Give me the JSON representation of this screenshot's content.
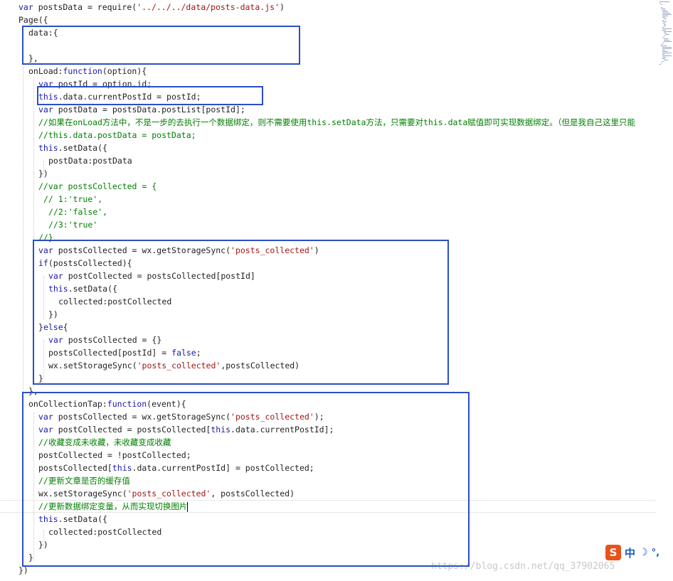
{
  "editor": {
    "lines": [
      {
        "indent": 3,
        "tokens": [
          {
            "t": "var",
            "c": "kw"
          },
          {
            "t": " postsData = require("
          },
          {
            "t": "'../../../data/posts-data.js'",
            "c": "str"
          },
          {
            "t": ")"
          }
        ]
      },
      {
        "indent": 3,
        "tokens": [
          {
            "t": "Page({"
          }
        ]
      },
      {
        "indent": 5,
        "tokens": [
          {
            "t": "data:{"
          }
        ]
      },
      {
        "indent": 0,
        "tokens": []
      },
      {
        "indent": 5,
        "tokens": [
          {
            "t": "},"
          }
        ]
      },
      {
        "indent": 5,
        "tokens": [
          {
            "t": "onLoad:"
          },
          {
            "t": "function",
            "c": "kw"
          },
          {
            "t": "(option){"
          }
        ]
      },
      {
        "indent": 7,
        "tokens": [
          {
            "t": "var",
            "c": "kw"
          },
          {
            "t": " postId = option.id;"
          }
        ]
      },
      {
        "indent": 7,
        "tokens": [
          {
            "t": "this",
            "c": "kw"
          },
          {
            "t": ".data.currentPostId = postId;"
          }
        ]
      },
      {
        "indent": 7,
        "tokens": [
          {
            "t": "var",
            "c": "kw"
          },
          {
            "t": " postData = postsData.postList[postId];"
          }
        ]
      },
      {
        "indent": 7,
        "tokens": [
          {
            "t": "//如果在onLoad方法中，不是一步的去执行一个数据绑定，则不需要使用this.setData方法，只需要对this.data赋值即可实现数据绑定。（但是我自己这里只能",
            "c": "cm"
          }
        ]
      },
      {
        "indent": 7,
        "tokens": [
          {
            "t": "//this.data.postData = postData;",
            "c": "cm"
          }
        ]
      },
      {
        "indent": 7,
        "tokens": [
          {
            "t": "this",
            "c": "kw"
          },
          {
            "t": ".setData({"
          }
        ]
      },
      {
        "indent": 9,
        "tokens": [
          {
            "t": "postData:postData"
          }
        ]
      },
      {
        "indent": 7,
        "tokens": [
          {
            "t": "})"
          }
        ]
      },
      {
        "indent": 7,
        "tokens": [
          {
            "t": "//var postsCollected = {",
            "c": "cm"
          }
        ]
      },
      {
        "indent": 8,
        "tokens": [
          {
            "t": "// 1:'true',",
            "c": "cm"
          }
        ]
      },
      {
        "indent": 9,
        "tokens": [
          {
            "t": "//2:'false',",
            "c": "cm"
          }
        ]
      },
      {
        "indent": 9,
        "tokens": [
          {
            "t": "//3:'true'",
            "c": "cm"
          }
        ]
      },
      {
        "indent": 7,
        "tokens": [
          {
            "t": "//}",
            "c": "cm"
          }
        ]
      },
      {
        "indent": 7,
        "tokens": [
          {
            "t": "var",
            "c": "kw"
          },
          {
            "t": " postsCollected = wx.getStorageSync("
          },
          {
            "t": "'posts_collected'",
            "c": "str"
          },
          {
            "t": ")"
          }
        ]
      },
      {
        "indent": 7,
        "tokens": [
          {
            "t": "if",
            "c": "kw"
          },
          {
            "t": "(postsCollected){"
          }
        ]
      },
      {
        "indent": 9,
        "tokens": [
          {
            "t": "var",
            "c": "kw"
          },
          {
            "t": " postCollected = postsCollected[postId]"
          }
        ]
      },
      {
        "indent": 9,
        "tokens": [
          {
            "t": "this",
            "c": "kw"
          },
          {
            "t": ".setData({"
          }
        ]
      },
      {
        "indent": 11,
        "tokens": [
          {
            "t": "collected:postCollected"
          }
        ]
      },
      {
        "indent": 9,
        "tokens": [
          {
            "t": "})"
          }
        ]
      },
      {
        "indent": 7,
        "tokens": [
          {
            "t": "}"
          },
          {
            "t": "else",
            "c": "kw"
          },
          {
            "t": "{"
          }
        ]
      },
      {
        "indent": 9,
        "tokens": [
          {
            "t": "var",
            "c": "kw"
          },
          {
            "t": " postsCollected = {}"
          }
        ]
      },
      {
        "indent": 9,
        "tokens": [
          {
            "t": "postsCollected[postId] = "
          },
          {
            "t": "false",
            "c": "kw"
          },
          {
            "t": ";"
          }
        ]
      },
      {
        "indent": 9,
        "tokens": [
          {
            "t": "wx.setStorageSync("
          },
          {
            "t": "'posts_collected'",
            "c": "str"
          },
          {
            "t": ",postsCollected)"
          }
        ]
      },
      {
        "indent": 7,
        "tokens": [
          {
            "t": "}"
          }
        ]
      },
      {
        "indent": 5,
        "tokens": [
          {
            "t": "},"
          }
        ]
      },
      {
        "indent": 5,
        "tokens": [
          {
            "t": "onCollectionTap:"
          },
          {
            "t": "function",
            "c": "kw"
          },
          {
            "t": "(event){"
          }
        ]
      },
      {
        "indent": 7,
        "tokens": [
          {
            "t": "var",
            "c": "kw"
          },
          {
            "t": " postsCollected = wx.getStorageSync("
          },
          {
            "t": "'posts_collected'",
            "c": "str"
          },
          {
            "t": ");"
          }
        ]
      },
      {
        "indent": 7,
        "tokens": [
          {
            "t": "var",
            "c": "kw"
          },
          {
            "t": " postCollected = postsCollected["
          },
          {
            "t": "this",
            "c": "kw"
          },
          {
            "t": ".data.currentPostId];"
          }
        ]
      },
      {
        "indent": 7,
        "tokens": [
          {
            "t": "//收藏变成未收藏，未收藏变成收藏",
            "c": "cm"
          }
        ]
      },
      {
        "indent": 7,
        "tokens": [
          {
            "t": "postCollected = !postCollected;"
          }
        ]
      },
      {
        "indent": 7,
        "tokens": [
          {
            "t": "postsCollected["
          },
          {
            "t": "this",
            "c": "kw"
          },
          {
            "t": ".data.currentPostId] = postCollected;"
          }
        ]
      },
      {
        "indent": 7,
        "tokens": [
          {
            "t": "//更新文章是否的缓存值",
            "c": "cm"
          }
        ]
      },
      {
        "indent": 7,
        "tokens": [
          {
            "t": "wx.setStorageSync("
          },
          {
            "t": "'posts_collected'",
            "c": "str"
          },
          {
            "t": ", postsCollected)"
          }
        ]
      },
      {
        "indent": 7,
        "tokens": [
          {
            "t": "//更新数据绑定变量，从而实现切换图片",
            "c": "cm"
          }
        ],
        "cursor": true
      },
      {
        "indent": 7,
        "tokens": [
          {
            "t": "this",
            "c": "kw"
          },
          {
            "t": ".setData({"
          }
        ]
      },
      {
        "indent": 9,
        "tokens": [
          {
            "t": "collected:postCollected"
          }
        ]
      },
      {
        "indent": 7,
        "tokens": [
          {
            "t": "})"
          }
        ]
      },
      {
        "indent": 5,
        "tokens": [
          {
            "t": "}"
          }
        ]
      },
      {
        "indent": 3,
        "tokens": [
          {
            "t": "})"
          }
        ]
      }
    ]
  },
  "highlight_color": "#2a4fc4",
  "ime": {
    "logo": "S",
    "language": "中",
    "moon_icon": "☽",
    "punct": "°,"
  },
  "watermark": "https://blog.csdn.net/qq_37902065"
}
